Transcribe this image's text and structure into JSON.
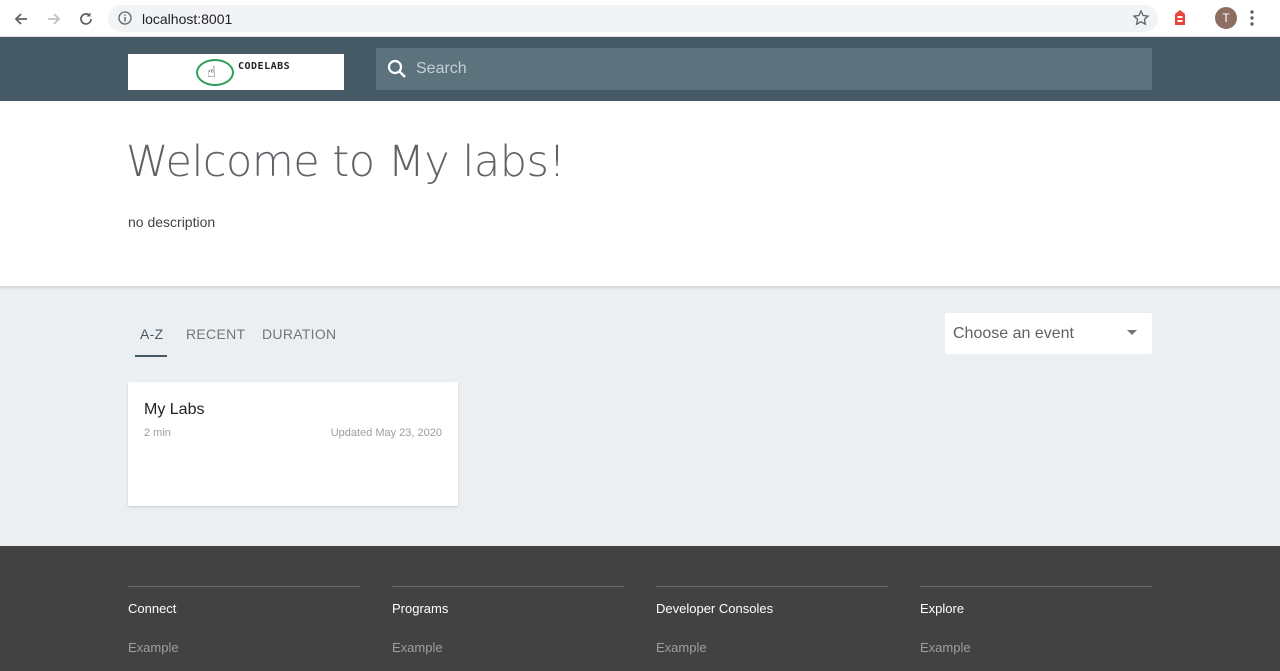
{
  "browser": {
    "url": "localhost:8001",
    "avatar_letter": "T"
  },
  "header": {
    "logo_text": "CODELABS",
    "search_placeholder": "Search"
  },
  "welcome": {
    "title": "Welcome to My labs!",
    "description": "no description"
  },
  "tabs": [
    {
      "label": "A-Z",
      "active": true
    },
    {
      "label": "RECENT",
      "active": false
    },
    {
      "label": "DURATION",
      "active": false
    }
  ],
  "event_select": {
    "value": "Choose an event"
  },
  "cards": [
    {
      "title": "My Labs",
      "duration": "2 min",
      "updated": "Updated May 23, 2020"
    }
  ],
  "footer": {
    "columns": [
      {
        "heading": "Connect",
        "link": "Example"
      },
      {
        "heading": "Programs",
        "link": "Example"
      },
      {
        "heading": "Developer Consoles",
        "link": "Example"
      },
      {
        "heading": "Explore",
        "link": "Example"
      }
    ]
  },
  "colors": {
    "header_bg": "#455a64",
    "page_bg": "#eceff1",
    "footer_bg": "#424242",
    "logo_ring": "#2e9e5a"
  }
}
